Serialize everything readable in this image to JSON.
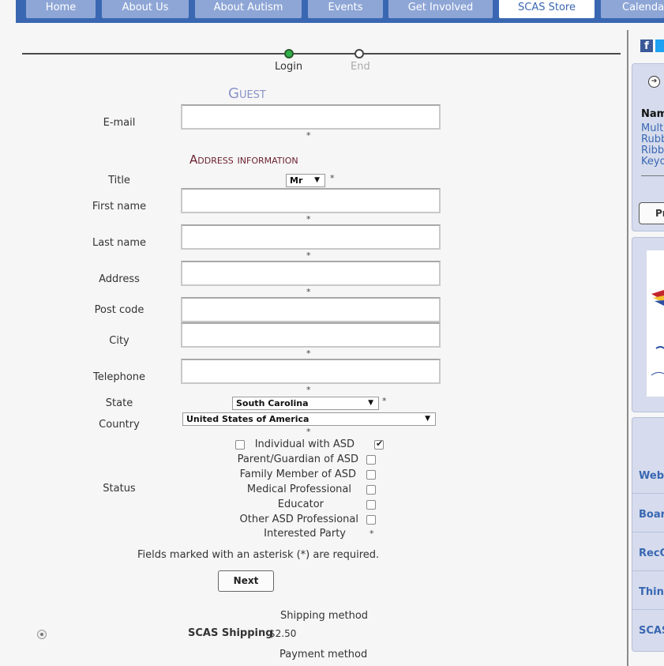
{
  "nav": {
    "tabs": [
      {
        "label": "Home"
      },
      {
        "label": "About Us"
      },
      {
        "label": "About Autism"
      },
      {
        "label": "Events"
      },
      {
        "label": "Get Involved"
      },
      {
        "label": "SCAS Store"
      },
      {
        "label": "Calendar"
      }
    ],
    "active_tab": "SCAS Store"
  },
  "progress": {
    "steps": [
      {
        "label": "Login",
        "state": "done"
      },
      {
        "label": "End",
        "state": "pending"
      }
    ]
  },
  "guest": {
    "title": "Guest",
    "email_label": "E-mail",
    "required_mark": "*"
  },
  "address": {
    "title": "Address information",
    "title_label": "Title",
    "title_value": "Mr",
    "first_name_label": "First name",
    "last_name_label": "Last name",
    "address_label": "Address",
    "post_code_label": "Post code",
    "city_label": "City",
    "telephone_label": "Telephone",
    "state_label": "State",
    "state_value": "South Carolina",
    "country_label": "Country",
    "country_value": "United States of America",
    "status_label": "Status",
    "status_options": [
      {
        "label": "Individual with ASD",
        "checked": true
      },
      {
        "label": "Parent/Guardian of ASD",
        "checked": false
      },
      {
        "label": "Family Member of ASD",
        "checked": false
      },
      {
        "label": "Medical Professional",
        "checked": false
      },
      {
        "label": "Educator",
        "checked": false
      },
      {
        "label": "Other ASD Professional",
        "checked": false
      },
      {
        "label": "Interested Party",
        "checked": false
      }
    ],
    "required_note": "Fields marked with an asterisk (*) are required."
  },
  "next_label": "Next",
  "shipping": {
    "header": "Shipping method",
    "option_name": "SCAS Shipping",
    "option_price": "$2.50"
  },
  "payment": {
    "header": "Payment method"
  },
  "sidebar": {
    "name_heading": "Nam",
    "items": [
      "Mult",
      "Rubb",
      "Ribb",
      "Keyo"
    ],
    "button_label": "Pr",
    "links": [
      "Webs",
      "Boar",
      "RecC",
      "Think",
      "SCAS"
    ]
  },
  "colors": {
    "nav_bar": "#3a67b2",
    "nav_tab": "#8ea6d6",
    "guest_title": "#8a93c8",
    "address_title": "#6a1f2e",
    "step_done": "#2fb24a",
    "sidebar_panel": "#d6dced"
  }
}
